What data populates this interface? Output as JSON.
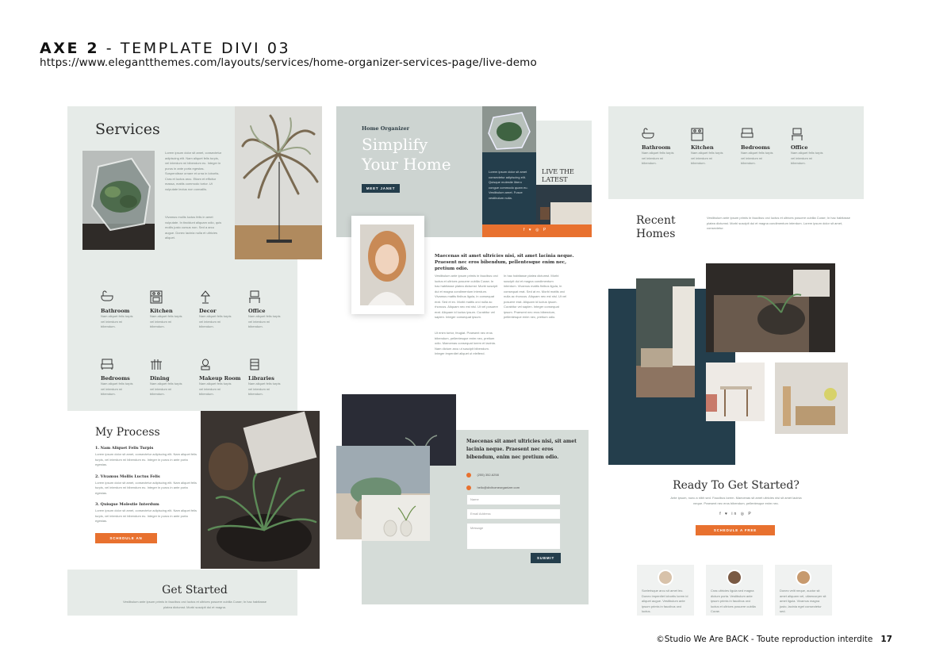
{
  "header": {
    "title_bold": "AXE 2",
    "title_rest": " - TEMPLATE DIVI 03",
    "url": "https://www.elegantthemes.com/layouts/services/home-organizer-services-page/live-demo"
  },
  "footer": {
    "credit": "©Studio We Are BACK - Toute reproduction interdite",
    "page": "17"
  },
  "colors": {
    "panel": "#e6ebe8",
    "accent": "#e8712f",
    "navy": "#243e4c"
  },
  "left": {
    "services_title": "Services",
    "services_text": "Lorem ipsum dolor sit amet, consectetur adipiscing elit. Nam aliquet felis turpis, vel interdum mi bibendum eu. Integer in purus in ante porta egestas. Suspendisse ornare et urna in lobortis. Cras et luctus arcu. Etiam et efficitur massa, mattis commodo tortor. Ut vulputate lectus non convallis.",
    "services_text2": "Vivamus mollis luctus felis in amet vulputate. In tincidunt aliquam odio, quis mollis justo cursus non. Sed a arcu augue. Donec lacinia nulla et ultricies aliquet.",
    "items": [
      {
        "label": "Bathroom",
        "icon": "bathtub-icon"
      },
      {
        "label": "Kitchen",
        "icon": "kitchen-icon"
      },
      {
        "label": "Decor",
        "icon": "lamp-icon"
      },
      {
        "label": "Office",
        "icon": "desk-icon"
      },
      {
        "label": "Bedrooms",
        "icon": "bed-icon"
      },
      {
        "label": "Dining",
        "icon": "dining-icon"
      },
      {
        "label": "Makeup Room",
        "icon": "mirror-icon"
      },
      {
        "label": "Libraries",
        "icon": "shelf-icon"
      }
    ],
    "item_text": "Nam aliquet felis turpis vel interdum mi bibendum.",
    "process_title": "My Process",
    "steps": [
      "1. Nam Aliquet Felis Turpis",
      "2. Vivamus Mollis Luctus Felis",
      "3. Quisque Molestie Interdum"
    ],
    "step_text": "Lorem ipsum dolor sit amet, consectetur adipiscing elit. Nam aliquet felis turpis, vel interdum mi bibendum eu. Integer in purus in ante porta egestas.",
    "process_button": "SCHEDULE AN APPOINTMENT",
    "get_started_title": "Get Started",
    "get_started_text": "Vestibulum ante ipsum primis in faucibus orci luctus et ultrices posuere cubilia Curae; In hac habitasse platea dictumst. Morbi suscipit dui et magna."
  },
  "middle": {
    "kicker": "Home Organizer",
    "hero_line1": "Simplify",
    "hero_line2": "Your Home",
    "hero_button": "MEET JANET",
    "navy_text": "Lorem ipsum dolor sit amet consectetur adipiscing elit. Quisque molestie libero congue commodo quam eu. Vestibulum amet. Fusce vestibulum nulla.",
    "live_line1": "LIVE THE",
    "live_line2": "LATEST",
    "social": "f ♥ ◎ P",
    "bio_heading": "Maecenas sit amet ultricies nisi, sit amet lacinia neque. Praesent nec eros bibendum, pellentesque enim nec, pretium odio.",
    "bio_col1": "Vestibulum ante ipsum primis in faucibus orci luctus et ultrices posuere cubilia Curae; In hac habitasse platea dictumst. Morbi suscipit dui et magna condimentum interdum. Vivamus mattis finibus ligula, in consequat erat. Sed et ex. Morbi mattis orci nulla ac rhoncus. Aliquam nec est nisl. Ut vel posuere erat. Aliquam id luctus ipsum. Curabitur vel sapien. Integer consequat ipsum.",
    "bio_col1b": "Ut enim tortor, feugiat. Praesent nec eros bibendum, pellentesque enim nec, pretium odio. Maecenas consequat lorem et lacinia. Nam dictum arcu ut suscipit bibendum. Integer imperdiet aliquet ut eleifend.",
    "bio_col2": "In hac habitasse platea dictumst. Morbi suscipit dui et magna condimentum interdum. Vivamus mattis finibus ligula, in consequat erat. Sed at ex. Morbi mattis orci nulla ac rhoncus. Aliquam nec est nisl. Ut vel posuere erat. Aliquam id luctus ipsum. Curabitur vel sapien. Integer consequat ipsum. Praesent nec eros bibendum, pellentesque enim nec, pretium odio.",
    "contact_heading": "Maecenas sit amet ultricies nisi, sit amet lacinia neque. Praesent nec eros bibendum, enim nec pretium odio.",
    "phone": "(255) 352-6258",
    "email": "hello@divihomeorganizer.com",
    "field_name": "Name",
    "field_email": "Email Address",
    "field_message": "Message",
    "submit": "SUBMIT"
  },
  "right": {
    "items": [
      {
        "label": "Bathroom",
        "icon": "bathtub-icon"
      },
      {
        "label": "Kitchen",
        "icon": "kitchen-icon"
      },
      {
        "label": "Bedrooms",
        "icon": "bed-icon"
      },
      {
        "label": "Office",
        "icon": "desk-icon"
      }
    ],
    "item_text": "Nam aliquet felis turpis vel interdum mi bibendum.",
    "recent_line1": "Recent",
    "recent_line2": "Homes",
    "recent_text": "Vestibulum ante ipsum primis in faucibus orci luctus et ultrices posuere cubilia Curae; In hac habitasse platea dictumst. Morbi suscipit dui et magna condimentum interdum. Lorem ipsum dolor sit amet, consectetur.",
    "cta_title": "Ready To Get Started?",
    "cta_text": "Ante ipsum, nunc a nibh sed. Faucibus lorem. Maecenas sit amet ultricies nisi sit amet lacinia neque. Praesent nec eros bibendum, pellentesque enim nec.",
    "social": "f ♥ in ◎ P",
    "cta_button": "SCHEDULE A FREE CONSULTATION",
    "testimonials": [
      "Scelerisque arcu sit amet leo. Donec imperdiet lobortis lorem id aliquet augue. Vestibulum ante ipsum primis in faucibus orci luctus.",
      "Cras ultricies ligula sed magna dictum porta. Vestibulum ante ipsum primis in faucibus orci luctus et ultrices posuere cubilia Curae.",
      "Donec velit neque, auctor sit amet aliquam vel, ullamcorper sit amet ligula. Vivamus magna justo, lacinia eget consectetur sed."
    ]
  }
}
